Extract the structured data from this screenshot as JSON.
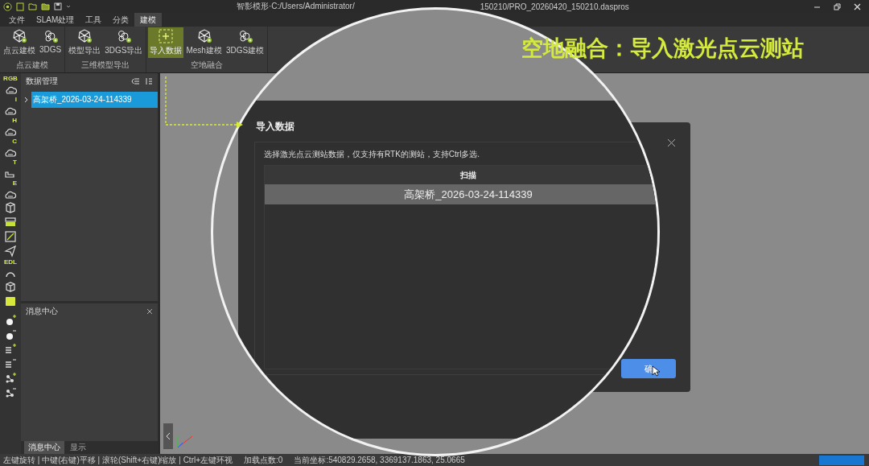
{
  "window": {
    "title_left": "智影模形·C:/Users/Administrator/",
    "title_right": "150210/PRO_20260420_150210.daspros"
  },
  "menu_tabs": [
    {
      "label": "文件",
      "selected": false
    },
    {
      "label": "SLAM处理",
      "selected": false
    },
    {
      "label": "工具",
      "selected": false
    },
    {
      "label": "分类",
      "selected": false
    },
    {
      "label": "建模",
      "selected": true
    }
  ],
  "ribbon": {
    "groups": [
      {
        "label": "点云建模",
        "buttons": [
          {
            "label": "点云建模",
            "kind": "mesh",
            "selected": false
          },
          {
            "label": "3DGS",
            "kind": "gs",
            "selected": false
          }
        ]
      },
      {
        "label": "三维模型导出",
        "buttons": [
          {
            "label": "模型导出",
            "kind": "mesh",
            "selected": false
          },
          {
            "label": "3DGS导出",
            "kind": "gs",
            "selected": false
          }
        ]
      },
      {
        "label": "空地融合",
        "buttons": [
          {
            "label": "导入数据",
            "kind": "import",
            "selected": true
          },
          {
            "label": "Mesh建模",
            "kind": "mesh",
            "selected": false
          },
          {
            "label": "3DGS建模",
            "kind": "gs",
            "selected": false
          }
        ]
      }
    ]
  },
  "tool_strip": [
    {
      "kind": "cloud",
      "badge": "RGB"
    },
    {
      "kind": "cloud",
      "badge": "I"
    },
    {
      "kind": "cloud",
      "badge": "H"
    },
    {
      "kind": "cloud",
      "badge": "C"
    },
    {
      "kind": "steps",
      "badge": "T"
    },
    {
      "kind": "cloud",
      "badge": "E"
    },
    {
      "kind": "box"
    },
    {
      "kind": "layers"
    },
    {
      "kind": "slash-square"
    },
    {
      "kind": "plane"
    },
    {
      "kind": "arc",
      "badge": "EDL"
    },
    {
      "kind": "cube"
    },
    {
      "kind": "block"
    },
    {
      "kind": "dot-add"
    },
    {
      "kind": "dot-remove"
    },
    {
      "kind": "list-add"
    },
    {
      "kind": "list-remove"
    },
    {
      "kind": "net-add"
    },
    {
      "kind": "net-remove"
    }
  ],
  "data_panel": {
    "title": "数据管理",
    "tree": [
      {
        "label": "高架桥_2026-03-24-114339",
        "selected": true,
        "expanded": false
      }
    ]
  },
  "message_panel": {
    "title": "消息中心",
    "tabs": [
      {
        "label": "消息中心",
        "selected": true
      },
      {
        "label": "显示",
        "selected": false
      }
    ]
  },
  "caption": "空地融合：导入激光点云测站",
  "dialog": {
    "title": "导入数据",
    "instruction": "选择激光点云测站数据，仅支持有RTK的测站，支持Ctrl多选.",
    "columns": [
      "扫描"
    ],
    "rows": [
      {
        "name": "高架桥_2026-03-24-114339",
        "selected": true
      }
    ],
    "confirm_button": "确"
  },
  "status_bar": {
    "hint": "左键旋转 | 中键(右键)平移 | 滚轮(Shift+右键)缩放 | Ctrl+左键环视",
    "points": "加载点数:0",
    "coords": "当前坐标:540829.2658, 3369137.1863, 25.0665"
  }
}
